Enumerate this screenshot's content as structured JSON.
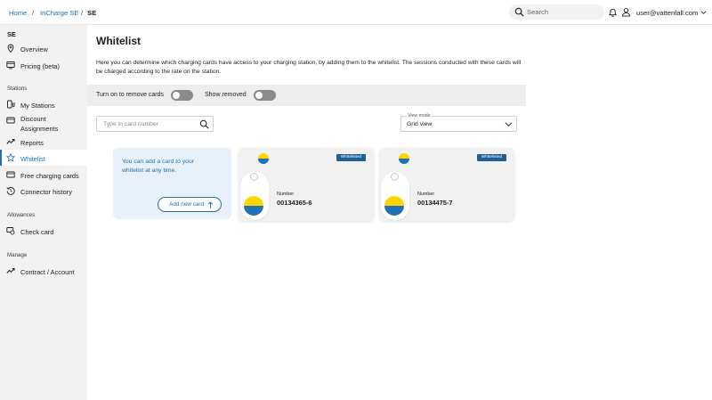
{
  "header": {
    "breadcrumbs": [
      "Home",
      "InCharge SE",
      "SE"
    ],
    "separator": "/",
    "search": {
      "placeholder": "Search",
      "value": ""
    },
    "icons": [
      "search-icon",
      "bell-icon",
      "user-icon",
      "chevron-down-icon"
    ],
    "user_email": "user@vattenfall.com"
  },
  "sidebar": {
    "country": "SE",
    "items_top": [
      {
        "label": "Overview",
        "icon": "pin-icon"
      },
      {
        "label": "Pricing (beta)",
        "icon": "pricing-icon"
      }
    ],
    "section_stations": "Stations",
    "items_stations": [
      {
        "label": "My Stations",
        "icon": "charger-icon"
      },
      {
        "label": "Discount",
        "label2": "Assignments",
        "icon": "card-discount-icon"
      },
      {
        "label": "Reports",
        "icon": "trend-icon"
      },
      {
        "label": "Whitelist",
        "icon": "star-icon",
        "active": true
      },
      {
        "label": "Free charging cards",
        "icon": "card-icon"
      },
      {
        "label": "Connector history",
        "icon": "history-icon"
      }
    ],
    "section_allowances": "Allowances",
    "items_allowances": [
      {
        "label": "Check card",
        "icon": "check-card-icon"
      }
    ],
    "section_manage": "Manage",
    "items_manage": [
      {
        "label": "Contract / Account",
        "icon": "trend-icon"
      }
    ]
  },
  "main": {
    "title": "Whitelist",
    "intro": "Here you can determine which charging cards have access to your charging station, by adding them to the whitelist. The sessions conducted with these cards will be charged according to the rate on the station.",
    "toggle_remove_label": "Turn on to remove cards",
    "toggle_remove_on": false,
    "toggle_show_removed_label": "Show removed",
    "toggle_show_removed_on": false,
    "card_search": {
      "placeholder": "Type in card number",
      "value": ""
    },
    "view_mode": {
      "label": "View mode",
      "value": "Grid view"
    },
    "add_card": {
      "message": "You can add a card to your whitelist at any time.",
      "button_label": "Add new card"
    },
    "cards": [
      {
        "badge": "Whitelisted",
        "number_label": "Number",
        "number": "00134365-6"
      },
      {
        "badge": "Whitelisted",
        "number_label": "Number",
        "number": "00134475-7"
      }
    ]
  },
  "colors": {
    "accent": "#2071b5",
    "badge": "#1f5f98",
    "sidebar_bg": "#f2f2f2",
    "logo_yellow": "#ffd500",
    "logo_blue": "#2071b5"
  }
}
